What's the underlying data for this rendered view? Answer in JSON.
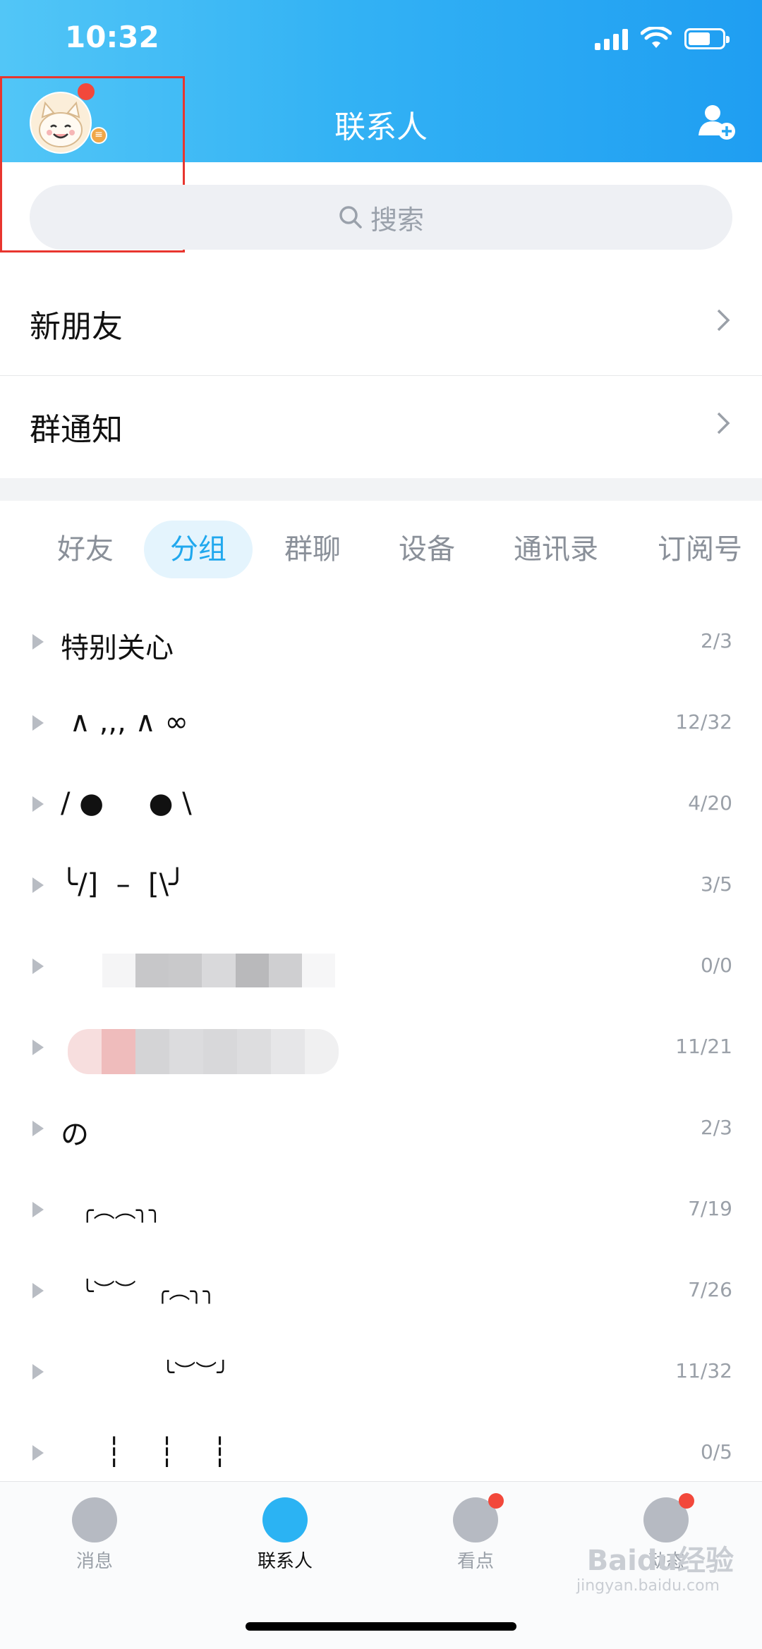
{
  "status": {
    "time": "10:32"
  },
  "header": {
    "title": "联系人"
  },
  "search": {
    "placeholder": "搜索"
  },
  "rows": [
    {
      "label": "新朋友"
    },
    {
      "label": "群通知"
    }
  ],
  "tabs": [
    "好友",
    "分组",
    "群聊",
    "设备",
    "通讯录",
    "订阅号"
  ],
  "active_tab": "分组",
  "groups": [
    {
      "name": "特别关心",
      "count": "2/3"
    },
    {
      "name": " ∧ ,,, ∧ ∞",
      "count": "12/32"
    },
    {
      "name": "/ ●     ● \\",
      "count": "4/20"
    },
    {
      "name": "╰/]  –  [\\╯",
      "count": "3/5"
    },
    {
      "name": "",
      "count": "0/0"
    },
    {
      "name": "",
      "count": "11/21"
    },
    {
      "name": "の",
      "count": "2/3"
    },
    {
      "name": "   ╭︵︵╮╮",
      "count": "7/19"
    },
    {
      "name": "   ╰︶︶   ╭︵╮╮",
      "count": "7/26"
    },
    {
      "name": "               ╰︶︶╯",
      "count": "11/32"
    },
    {
      "name": "     ┆    ┆    ┆",
      "count": "0/5"
    }
  ],
  "tabbar": [
    {
      "label": "消息",
      "icon": "message-icon"
    },
    {
      "label": "联系人",
      "icon": "contacts-icon"
    },
    {
      "label": "看点",
      "icon": "eye-icon"
    },
    {
      "label": "动态",
      "icon": "planet-icon"
    }
  ],
  "watermark": {
    "text": "Baidu经验",
    "sub": "jingyan.baidu.com"
  },
  "colors": {
    "accent": "#20a8ee",
    "badge": "#f2483b",
    "annotation": "#e8362f"
  }
}
